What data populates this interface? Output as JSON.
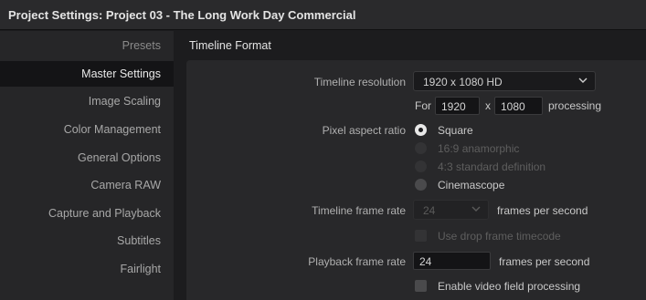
{
  "window": {
    "title": "Project Settings:  Project 03 - The Long Work Day Commercial"
  },
  "sidebar": {
    "items": [
      {
        "label": "Presets"
      },
      {
        "label": "Master Settings",
        "selected": true
      },
      {
        "label": "Image Scaling"
      },
      {
        "label": "Color Management"
      },
      {
        "label": "General Options"
      },
      {
        "label": "Camera RAW"
      },
      {
        "label": "Capture and Playback"
      },
      {
        "label": "Subtitles"
      },
      {
        "label": "Fairlight"
      }
    ]
  },
  "main": {
    "section_title": "Timeline Format",
    "timeline_resolution": {
      "label": "Timeline resolution",
      "value": "1920 x 1080 HD",
      "for_label": "For",
      "width": "1920",
      "x_label": "x",
      "height": "1080",
      "processing_label": "processing"
    },
    "pixel_aspect": {
      "label": "Pixel aspect ratio",
      "options": [
        {
          "label": "Square",
          "state": "selected"
        },
        {
          "label": "16:9 anamorphic",
          "state": "disabled"
        },
        {
          "label": "4:3 standard definition",
          "state": "disabled"
        },
        {
          "label": "Cinemascope",
          "state": "enabled"
        }
      ]
    },
    "timeline_frame_rate": {
      "label": "Timeline frame rate",
      "value": "24",
      "unit": "frames per second",
      "drop_frame_label": "Use drop frame timecode"
    },
    "playback_frame_rate": {
      "label": "Playback frame rate",
      "value": "24",
      "unit": "frames per second"
    },
    "video_field": {
      "label": "Enable video field processing",
      "checked": false
    }
  }
}
